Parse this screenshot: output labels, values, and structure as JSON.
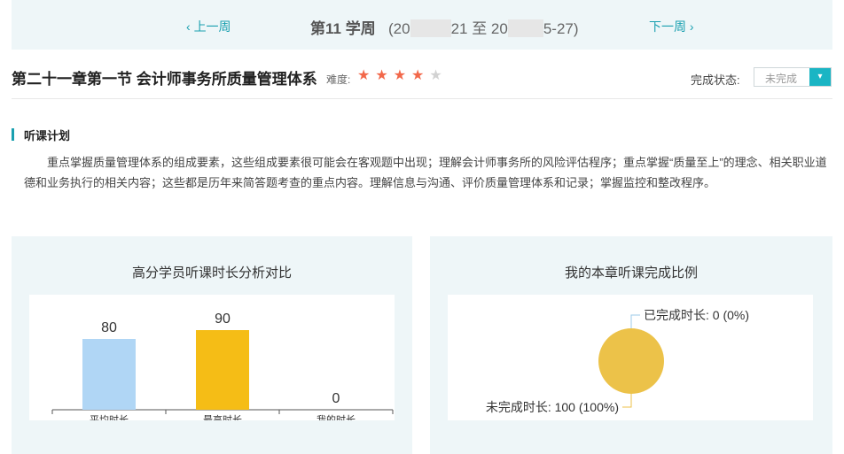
{
  "week_nav": {
    "prev_label": "上一周",
    "next_label": "下一周",
    "title": "第11 学周",
    "range_start_prefix": "(20",
    "range_start_suffix": "21 至 20",
    "range_end_suffix": "5-27)"
  },
  "chapter": {
    "title": "第二十一章第一节 会计师事务所质量管理体系",
    "difficulty_label": "难度:",
    "difficulty_rating": 4,
    "difficulty_max": 5,
    "status_label": "完成状态:",
    "status_value": "未完成"
  },
  "plan": {
    "heading": "听课计划",
    "text": "重点掌握质量管理体系的组成要素，这些组成要素很可能会在客观题中出现；理解会计师事务所的风险评估程序；重点掌握“质量至上”的理念、相关职业道德和业务执行的相关内容；这些都是历年来简答题考查的重点内容。理解信息与沟通、评价质量管理体系和记录；掌握监控和整改程序。"
  },
  "bar_panel": {
    "title": "高分学员听课时长分析对比"
  },
  "pie_panel": {
    "title": "我的本章听课完成比例"
  },
  "chart_data": [
    {
      "type": "bar",
      "title": "高分学员听课时长分析对比",
      "categories": [
        "平均时长",
        "最高时长",
        "我的时长"
      ],
      "values": [
        80,
        90,
        0
      ],
      "colors": [
        "#b0d6f5",
        "#f5bd16",
        "#b0d6f5"
      ],
      "data_labels": [
        "80",
        "90",
        "0"
      ],
      "ylim": [
        0,
        100
      ]
    },
    {
      "type": "pie",
      "title": "我的本章听课完成比例",
      "slices": [
        {
          "label": "已完成时长: 0 (0%)",
          "value": 0,
          "color": "#9ccbe8"
        },
        {
          "label": "未完成时长: 100 (100%)",
          "value": 100,
          "color": "#ecc249"
        }
      ]
    }
  ]
}
